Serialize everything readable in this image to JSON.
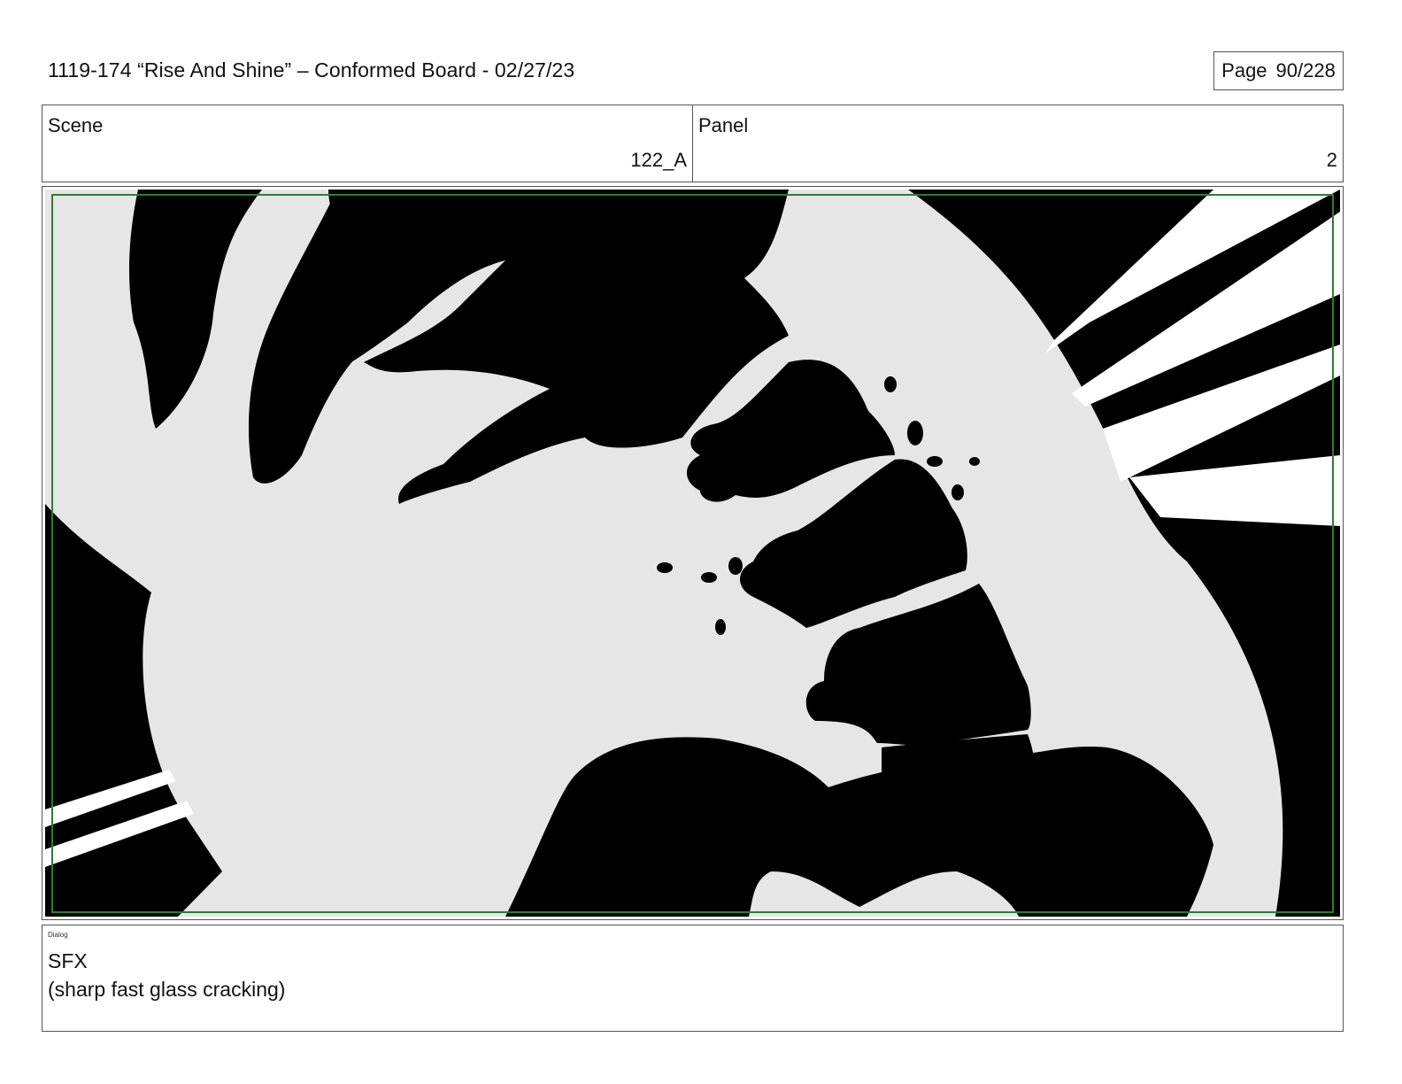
{
  "header": {
    "title": "1119-174 “Rise And Shine” – Conformed Board - 02/27/23",
    "page_label": "Page",
    "page_value": "90/228"
  },
  "info": {
    "scene_label": "Scene",
    "scene_value": "122_A",
    "panel_label": "Panel",
    "panel_value": "2"
  },
  "artwork": {
    "safe_frame_color": "#2e7d32",
    "background_color": "#e6e6e6",
    "ink_color": "#000000"
  },
  "dialog": {
    "tag": "Dialog",
    "lines": [
      "SFX",
      "(sharp fast glass cracking)"
    ]
  }
}
